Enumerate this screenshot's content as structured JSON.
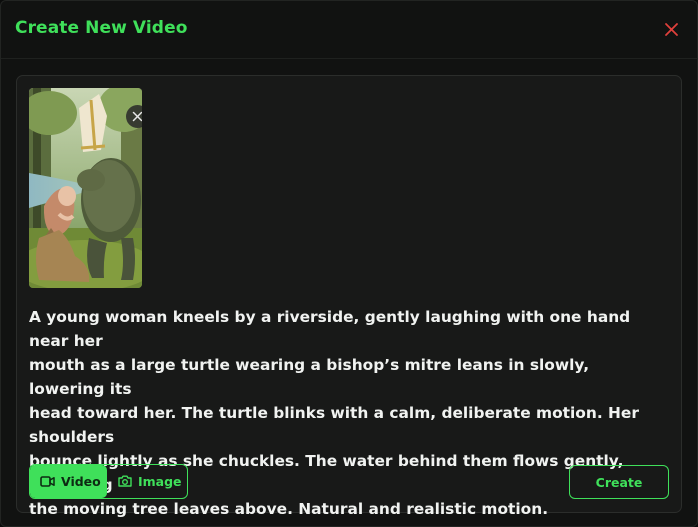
{
  "dialog": {
    "title": "Create New Video",
    "close_icon": "close-icon",
    "accent_color": "#3fe05a",
    "close_color": "#e0403c"
  },
  "attachment": {
    "remove_icon": "close-icon"
  },
  "prompt": {
    "text": "A young woman kneels by a riverside, gently laughing with one hand near her\nmouth as a large turtle wearing a bishop’s mitre leans in slowly, lowering its\nhead toward her. The turtle blinks with a calm, deliberate motion. Her shoulders\nbounce lightly as she chuckles. The water behind them flows gently, reflecting\nthe moving tree leaves above. Natural and realistic motion."
  },
  "mode_toggle": {
    "video_label": "Video",
    "video_icon": "video-camera-icon",
    "image_label": "Image",
    "image_icon": "camera-icon",
    "selected": "Video"
  },
  "actions": {
    "create_label": "Create"
  }
}
